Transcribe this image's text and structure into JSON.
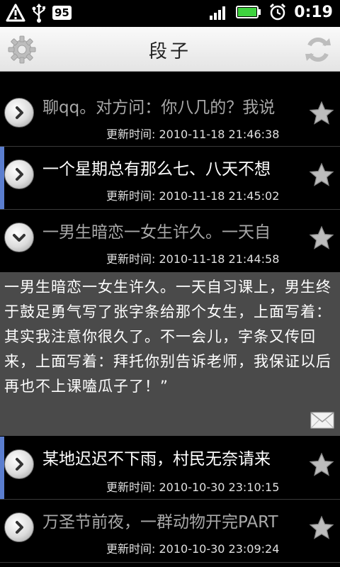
{
  "status_bar": {
    "battery_badge": "95",
    "clock": "0:19",
    "icons": [
      "warning-icon",
      "usb-icon",
      "battery-level-badge",
      "signal-bars-icon",
      "battery-icon",
      "alarm-clock-icon"
    ]
  },
  "title_bar": {
    "title": "段子",
    "left_icon": "gear-icon",
    "right_icon": "refresh-icon"
  },
  "list": {
    "items": [
      {
        "headline": "聊qq。对方问：你八几的？我说",
        "time": "更新时间: 2010-11-18 21:46:38",
        "read": true,
        "expanded": false
      },
      {
        "headline": "一个星期总有那么七、八天不想",
        "time": "更新时间: 2010-11-18 21:45:02",
        "read": false,
        "expanded": false
      },
      {
        "headline": "一男生暗恋一女生许久。一天自",
        "time": "更新时间: 2010-11-18 21:44:58",
        "read": true,
        "expanded": true
      },
      {
        "headline": "某地迟迟不下雨，村民无奈请来",
        "time": "更新时间: 2010-10-30 23:10:15",
        "read": false,
        "expanded": false
      },
      {
        "headline": "万圣节前夜，一群动物开完PART",
        "time": "更新时间: 2010-10-30 23:09:24",
        "read": true,
        "expanded": false
      }
    ]
  },
  "detail": {
    "text": "一男生暗恋一女生许久。一天自习课上，男生终于鼓足勇气写了张字条给那个女生，上面写着：其实我注意你很久了。不一会儿，字条又传回来，上面写着：拜托你别告诉老师，我保证以后再也不上课嗑瓜子了！”"
  },
  "colors": {
    "accent_unread": "#5b7ecf",
    "read_text": "#a8a8a8",
    "unread_text": "#ffffff",
    "detail_background": "#4a4a4a"
  }
}
